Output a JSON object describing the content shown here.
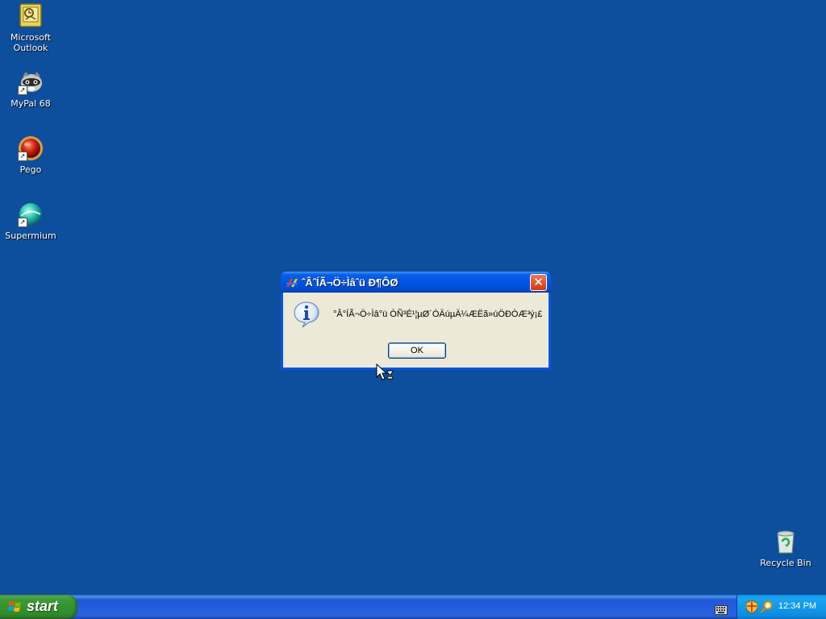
{
  "desktop": {
    "background": "#0d4f9d",
    "icons": [
      {
        "label": "Microsoft\nOutlook",
        "icon": "outlook-icon"
      },
      {
        "label": "MyPal 68",
        "icon": "mypal-raccoon-icon"
      },
      {
        "label": "Pego",
        "icon": "pego-red-orb-icon"
      },
      {
        "label": "Supermium",
        "icon": "supermium-globe-icon"
      }
    ],
    "recycle_bin": {
      "label": "Recycle Bin",
      "icon": "recycle-bin-icon"
    }
  },
  "dialog": {
    "title": "ˆÂˆÍÃ¬Ö÷Ìâˆü Ð¶ÔØ",
    "message": "°Â°ÍÃ¬Ö÷Ìâ°ü  ÒÑ³É¹¦µØ´ÓÄúµÄ¼ÆËã»úÖÐÒÆ³ý¡£",
    "ok_label": "OK",
    "close_glyph": "✕",
    "accent": "#0855dd"
  },
  "taskbar": {
    "start_label": "start",
    "clock": "12:34 PM",
    "tray_icons": [
      "keyboard-language-icon",
      "security-shield-icon",
      "search-magnifier-icon"
    ]
  }
}
